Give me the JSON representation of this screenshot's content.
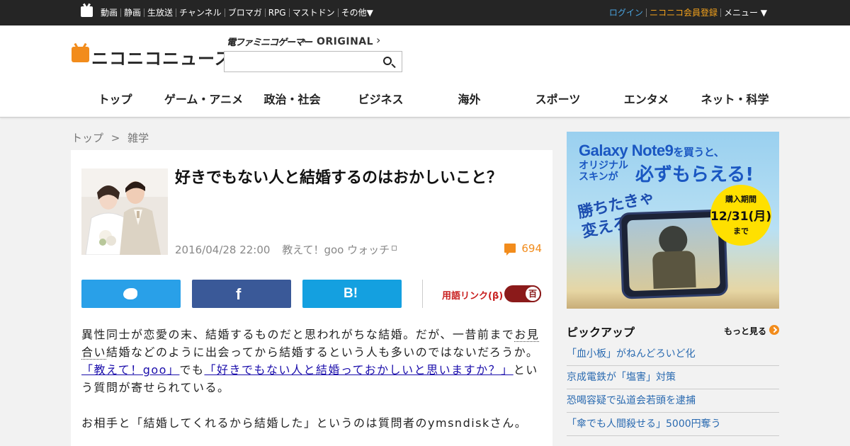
{
  "topbar": {
    "icon": "niconico-tv-icon",
    "nav": [
      "動画",
      "静画",
      "生放送",
      "チャンネル",
      "ブロマガ",
      "RPG",
      "マストドン",
      "その他▼"
    ],
    "login": "ログイン",
    "register": "ニコニコ会員登録",
    "menu": "メニュー ▼",
    "colors": {
      "bar": "#252525",
      "login": "#4aa3df",
      "register": "#f4a21c"
    }
  },
  "header": {
    "logo_text": "ニコニコニュース",
    "crumb_1": "電ファミニコゲーマー",
    "crumb_2": "ORIGINAL",
    "search": {
      "value": "",
      "icon": "search-icon"
    },
    "nav": [
      "トップ",
      "ゲーム・アニメ",
      "政治・社会",
      "ビジネス",
      "海外",
      "スポーツ",
      "エンタメ",
      "ネット・科学"
    ],
    "brand_color": "#f28c1c"
  },
  "breadcrumb": {
    "home": "トップ",
    "sep": ">",
    "current": "雑学"
  },
  "article": {
    "title": "好きでもない人と結婚するのはおかしいこと？",
    "date": "2016/04/28 22:00",
    "source": "教えて！goo ウォッチ",
    "comment_count": "694",
    "share": {
      "twitter": "twitter-icon",
      "facebook": "f",
      "hatena": "B!"
    },
    "term_link_label": "用語リンク(β)",
    "term_link_toggle": "百",
    "body": {
      "p1_a": "異性同士が恋愛の末、結婚するものだと思われがちな結婚。だが、一昔前まで",
      "p1_b_link": "お見合い",
      "p1_b_rest": "結婚などのように出会ってから結婚するという人も多いのではないだろうか。",
      "p2_link1": "「教えて！goo」",
      "p2_mid": "でも",
      "p2_link2": "「好きでもない人と結婚っておかしいと思いますか？」",
      "p2_rest": "という質問が寄せられている。",
      "p3": "お相手と「結婚してくれるから結婚した」というのは質問者のymsndiskさん。"
    },
    "colors": {
      "twitter": "#29a0e8",
      "facebook": "#3a5998",
      "hatena": "#14a0e0",
      "comments": "#f28c1c",
      "toggle": "#8b1a1a"
    }
  },
  "ad": {
    "title": "Galaxy Note9",
    "title_suffix": "を買うと、",
    "sub_left": "オリジナル スキンが",
    "sub_right": "必ずもらえる!",
    "slogan": "勝ちたきゃ 変えろ!",
    "badge_1": "購入期間",
    "badge_2": "12/31(月)",
    "badge_3": "まで"
  },
  "pickup": {
    "title": "ピックアップ",
    "more": "もっと見る",
    "items": [
      "「血小板」がねんどろいど化",
      "京成電鉄が「塩害」対策",
      "恐喝容疑で弘道会若頭を逮捕",
      "「傘でも人間殺せる」5000円奪う"
    ]
  }
}
